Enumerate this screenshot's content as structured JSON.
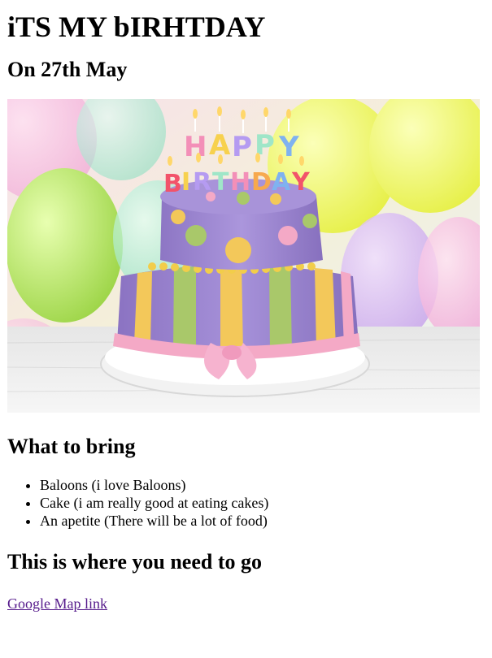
{
  "page": {
    "title": "iTS MY bIRHTDAY",
    "date": "On 27th May"
  },
  "hero_image": {
    "alt": "Two-tier purple birthday cake with HAPPY BIRTHDAY candles and balloons",
    "cake_letters_top": "HAPPY",
    "cake_letters_bottom": "BIRTHDAY"
  },
  "bring": {
    "heading": "What to bring",
    "items": [
      "Baloons (i love Baloons)",
      "Cake (i am really good at eating cakes)",
      "An apetite (There will be a lot of food)"
    ]
  },
  "directions": {
    "heading": "This is where you need to go",
    "link_label": "Google Map link"
  },
  "colors": {
    "link_visited": "#551a8b",
    "cake_purple": "#9f87cf",
    "stripe_yellow": "#f3c85a",
    "stripe_green": "#a9c86a",
    "ribbon_pink": "#f4a9c6"
  }
}
